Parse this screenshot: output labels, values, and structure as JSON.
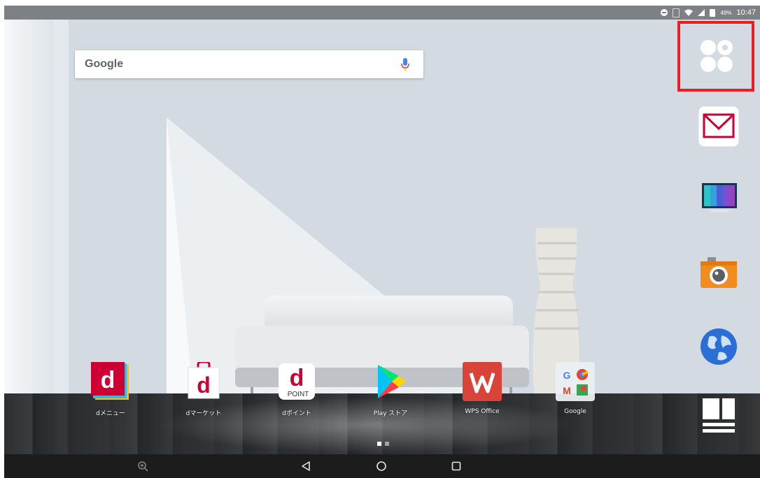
{
  "status_bar": {
    "battery_text": "49%",
    "time": "10:47",
    "icons": [
      "do-not-disturb-icon",
      "nfc-icon",
      "wifi-icon",
      "signal-icon",
      "battery-icon"
    ]
  },
  "search": {
    "logo_text": "Google",
    "mic_icon": "mic-icon"
  },
  "dock": {
    "items": [
      {
        "name": "all-apps-button",
        "icon": "app-drawer-icon"
      },
      {
        "name": "mail-app",
        "icon": "envelope-icon"
      },
      {
        "name": "tv-app",
        "icon": "television-icon"
      },
      {
        "name": "camera-app",
        "icon": "camera-icon"
      },
      {
        "name": "browser-app",
        "icon": "globe-icon"
      },
      {
        "name": "multi-window-app",
        "icon": "split-screen-icon"
      }
    ],
    "highlight_color": "#ea1c24"
  },
  "home_apps": [
    {
      "label": "dメニュー",
      "icon": "d-menu-icon"
    },
    {
      "label": "dマーケット",
      "icon": "d-market-icon"
    },
    {
      "label": "dポイント",
      "icon": "d-point-icon",
      "icon_text": "POINT"
    },
    {
      "label": "Play ストア",
      "icon": "play-store-icon"
    },
    {
      "label": "WPS Office",
      "icon": "wps-office-icon"
    },
    {
      "label": "Google",
      "icon": "google-folder-icon"
    }
  ],
  "page_indicator": {
    "count": 2,
    "active": 1
  },
  "nav_bar": {
    "buttons": [
      "zoom-icon",
      "back-icon",
      "home-icon",
      "recents-icon"
    ]
  },
  "colors": {
    "docomo_red": "#cc0033",
    "wps_red": "#d9443a",
    "camera_orange": "#f28c1f",
    "globe_blue": "#2a6ed8",
    "nav_bar": "#1c1c1d"
  }
}
